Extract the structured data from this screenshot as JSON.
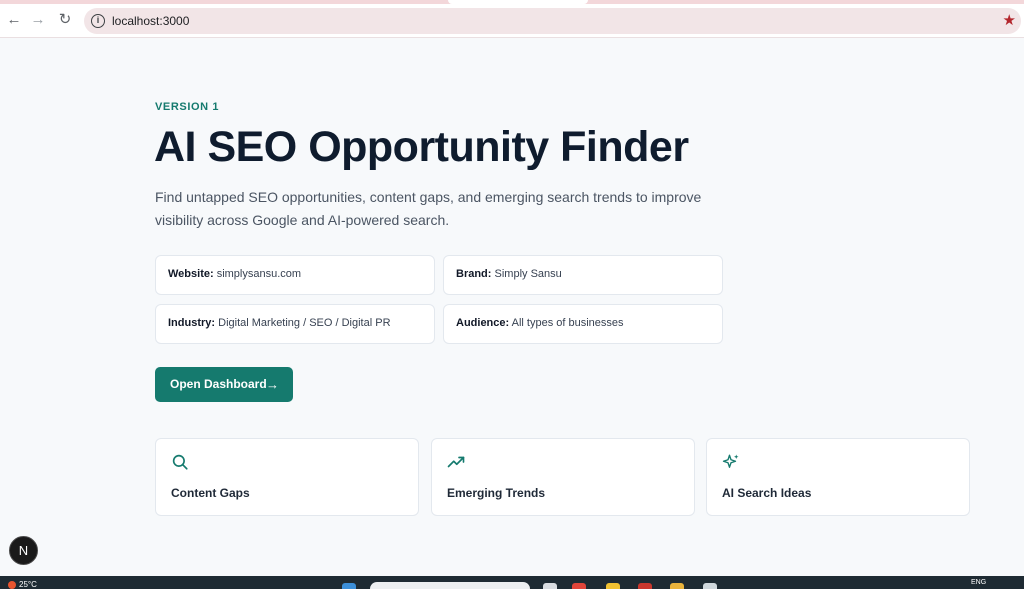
{
  "browser": {
    "url": "localhost:3000",
    "icons": [
      "back-icon",
      "forward-icon",
      "reload-icon",
      "site-info-icon",
      "bookmark-star-icon"
    ]
  },
  "hero": {
    "eyebrow": "VERSION 1",
    "title": "AI SEO Opportunity Finder",
    "subtitle": "Find untapped SEO opportunities, content gaps, and emerging search trends to improve visibility across Google and AI-powered search."
  },
  "details": [
    {
      "label": "Website:",
      "value": "simplysansu.com"
    },
    {
      "label": "Brand:",
      "value": "Simply Sansu"
    },
    {
      "label": "Industry:",
      "value": "Digital Marketing / SEO / Digital PR"
    },
    {
      "label": "Audience:",
      "value": "All types of businesses"
    }
  ],
  "cta": {
    "label": "Open Dashboard",
    "icon": "arrow-right-icon"
  },
  "features": [
    {
      "label": "Content Gaps",
      "icon": "search-icon"
    },
    {
      "label": "Emerging Trends",
      "icon": "trending-up-icon"
    },
    {
      "label": "AI Search Ideas",
      "icon": "sparkles-icon"
    }
  ],
  "dev_badge": "N",
  "taskbar": {
    "weather": "25°C",
    "lang": "ENG"
  },
  "colors": {
    "accent": "#157a6e",
    "title": "#0f1c2e",
    "background": "#f7f9fb"
  }
}
